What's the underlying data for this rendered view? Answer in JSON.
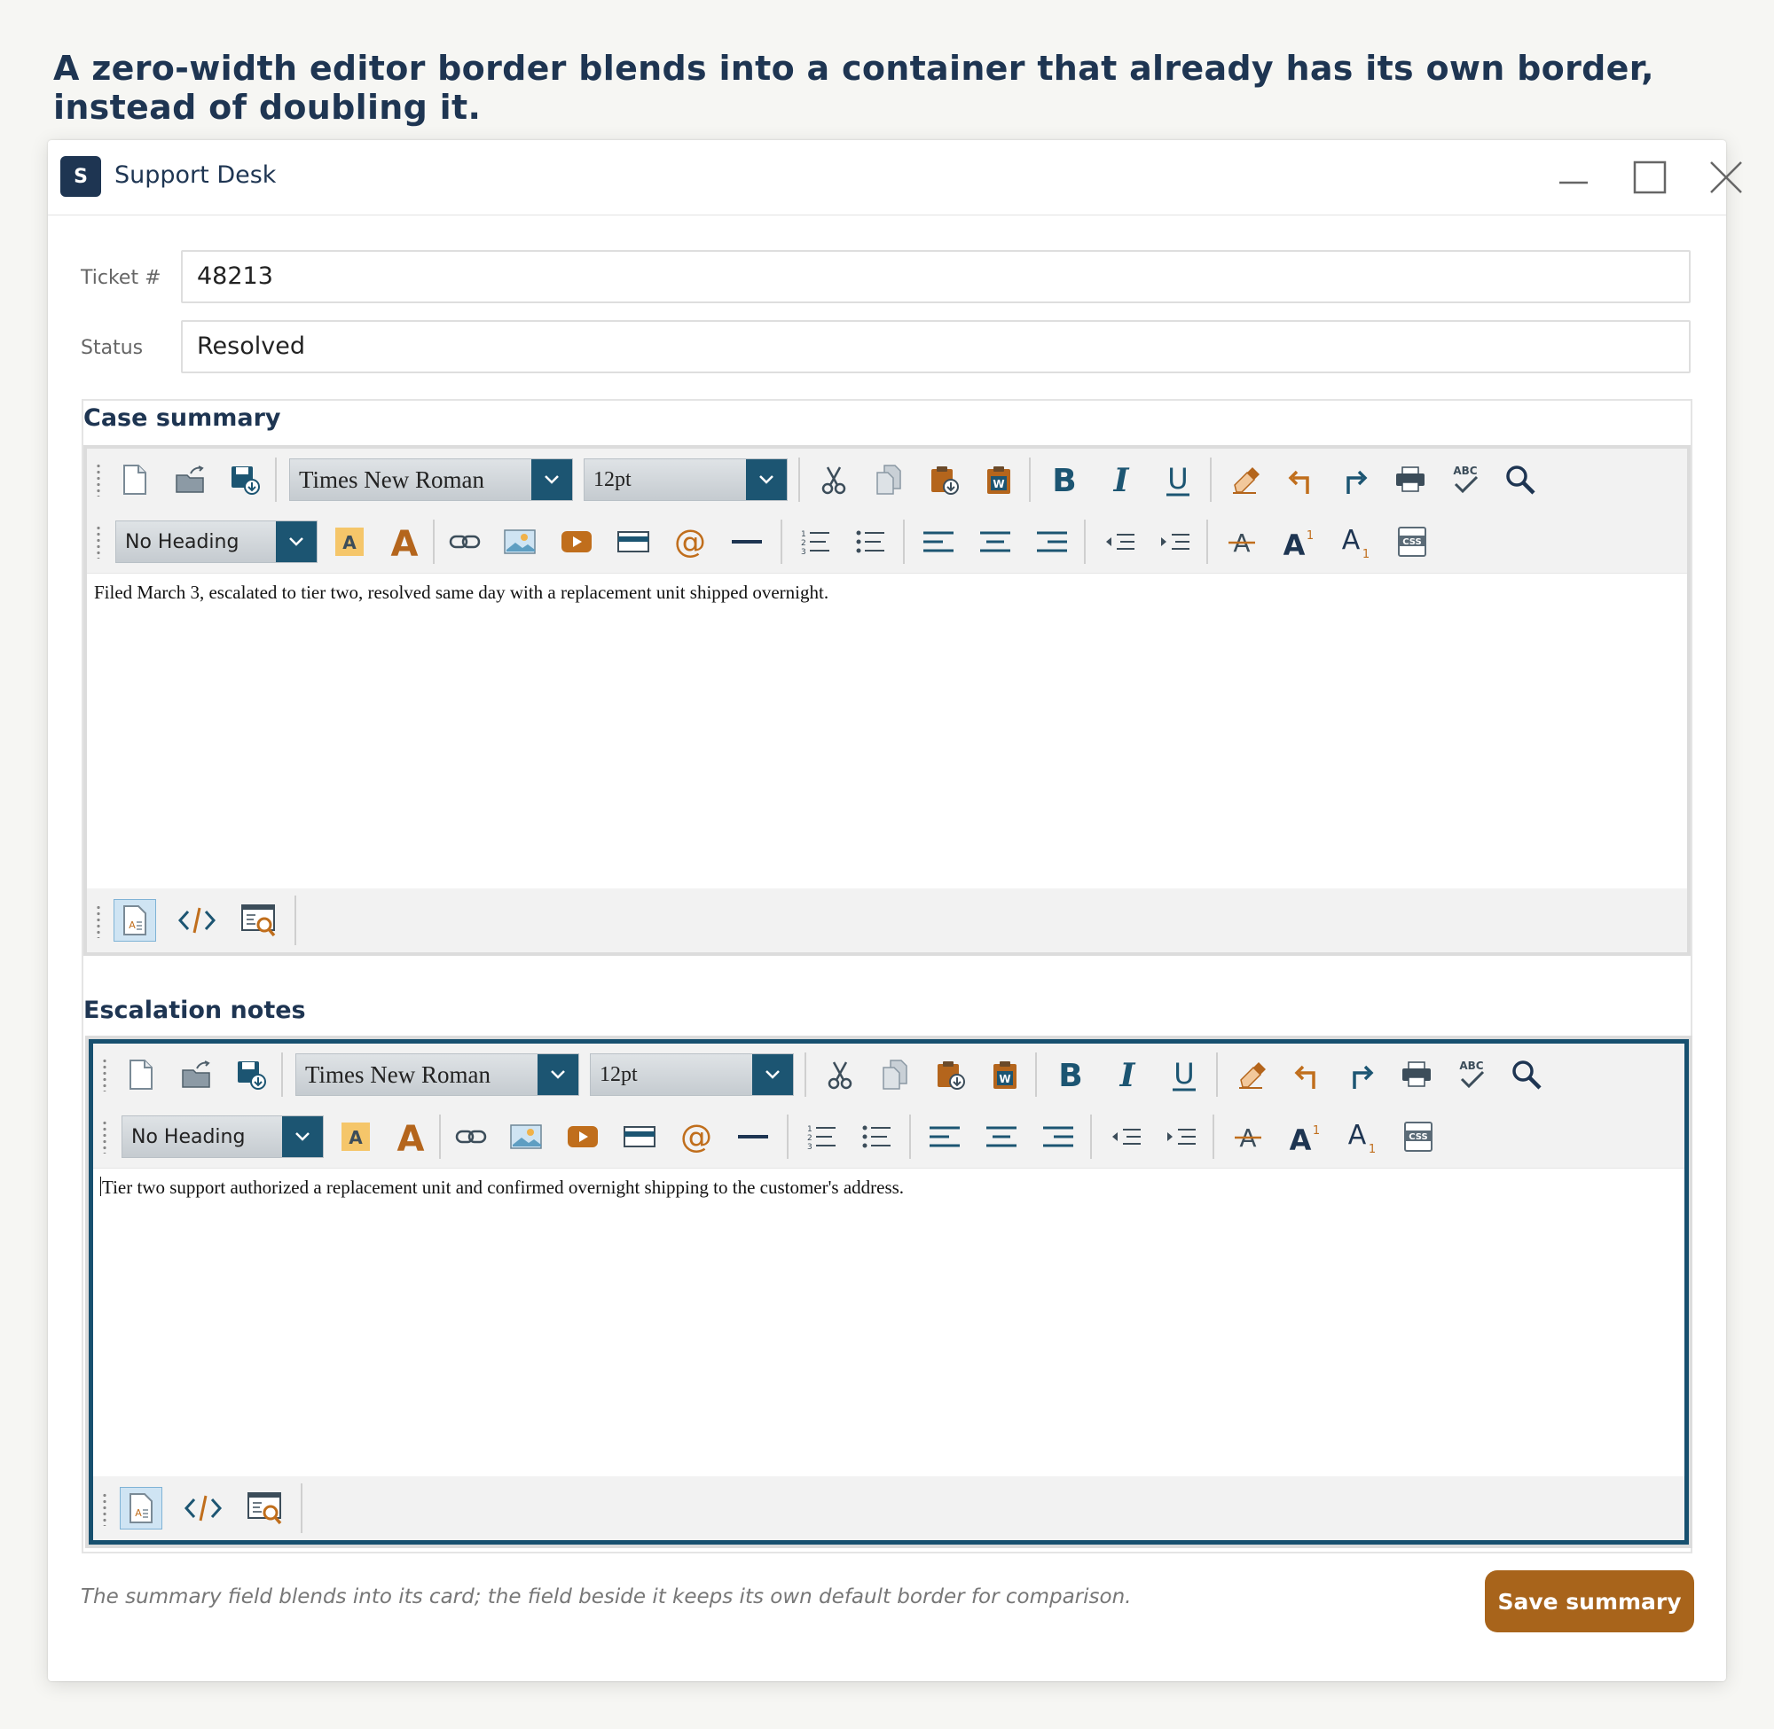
{
  "headline": "A zero-width editor border blends into a container that already has its own border, instead of doubling it.",
  "window": {
    "logo_letter": "S",
    "title": "Support Desk",
    "controls": [
      "minimize-icon",
      "maximize-icon",
      "close-icon"
    ]
  },
  "fields": {
    "ticket_label": "Ticket #",
    "ticket_value": "48213",
    "status_label": "Status",
    "status_value": "Resolved"
  },
  "toolbar": {
    "font_name": "Times New Roman",
    "font_size": "12pt",
    "heading": "No Heading",
    "icons_row1": [
      "new-document-icon",
      "open-folder-icon",
      "save-icon",
      "cut-icon",
      "copy-icon",
      "paste-icon",
      "paste-from-word-icon",
      "bold-icon",
      "italic-icon",
      "underline-icon",
      "eraser-icon",
      "undo-icon",
      "redo-icon",
      "print-icon",
      "spellcheck-icon",
      "find-icon"
    ],
    "icons_row2": [
      "highlight-color-icon",
      "font-color-icon",
      "link-icon",
      "image-icon",
      "video-icon",
      "media-icon",
      "email-link-icon",
      "horizontal-rule-icon",
      "ordered-list-icon",
      "unordered-list-icon",
      "align-left-icon",
      "align-center-icon",
      "align-right-icon",
      "outdent-icon",
      "indent-icon",
      "strikethrough-icon",
      "superscript-icon",
      "subscript-icon",
      "css-icon"
    ],
    "icons_bottom": [
      "design-mode-icon",
      "html-mode-icon",
      "preview-mode-icon"
    ]
  },
  "editors": {
    "summary": {
      "title": "Case summary",
      "content": "Filed March 3, escalated to tier two, resolved same day with a replacement unit shipped overnight."
    },
    "notes": {
      "title": "Escalation notes",
      "content": "Tier two support authorized a replacement unit and confirmed overnight shipping to the customer's address."
    }
  },
  "footer": {
    "note": "The summary field blends into its card; the field beside it keeps its own default border for comparison.",
    "save_label": "Save summary"
  },
  "colors": {
    "navy": "#1e3552",
    "editor_frame": "#17506f",
    "accent_orange": "#a8641b",
    "icon_blue": "#1c5572",
    "icon_orange": "#c06e1c"
  }
}
